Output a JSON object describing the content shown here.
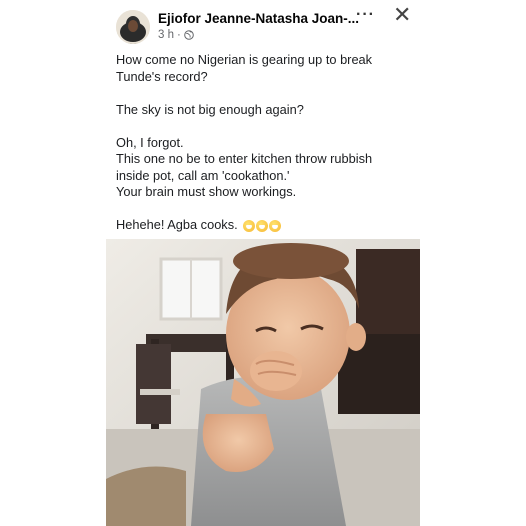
{
  "post": {
    "author": "Ejiofor Jeanne-Natasha Joan-...",
    "time": "3 h",
    "separator": "·",
    "more_label": "···",
    "close_label": "✕",
    "lines": [
      "How come no Nigerian is gearing up to break",
      "Tunde's record?",
      "",
      "The sky is not big enough again?",
      "",
      "Oh, I forgot.",
      "This one no be to enter kitchen throw rubbish",
      "inside pot, call am 'cookathon.'",
      "Your brain must show workings.",
      "",
      "Hehehe! Agba cooks."
    ],
    "emoji": [
      "grin-emoji",
      "grin-emoji",
      "grin-emoji"
    ],
    "photo": {
      "subject": "toddler-covering-mouth-photo"
    }
  }
}
